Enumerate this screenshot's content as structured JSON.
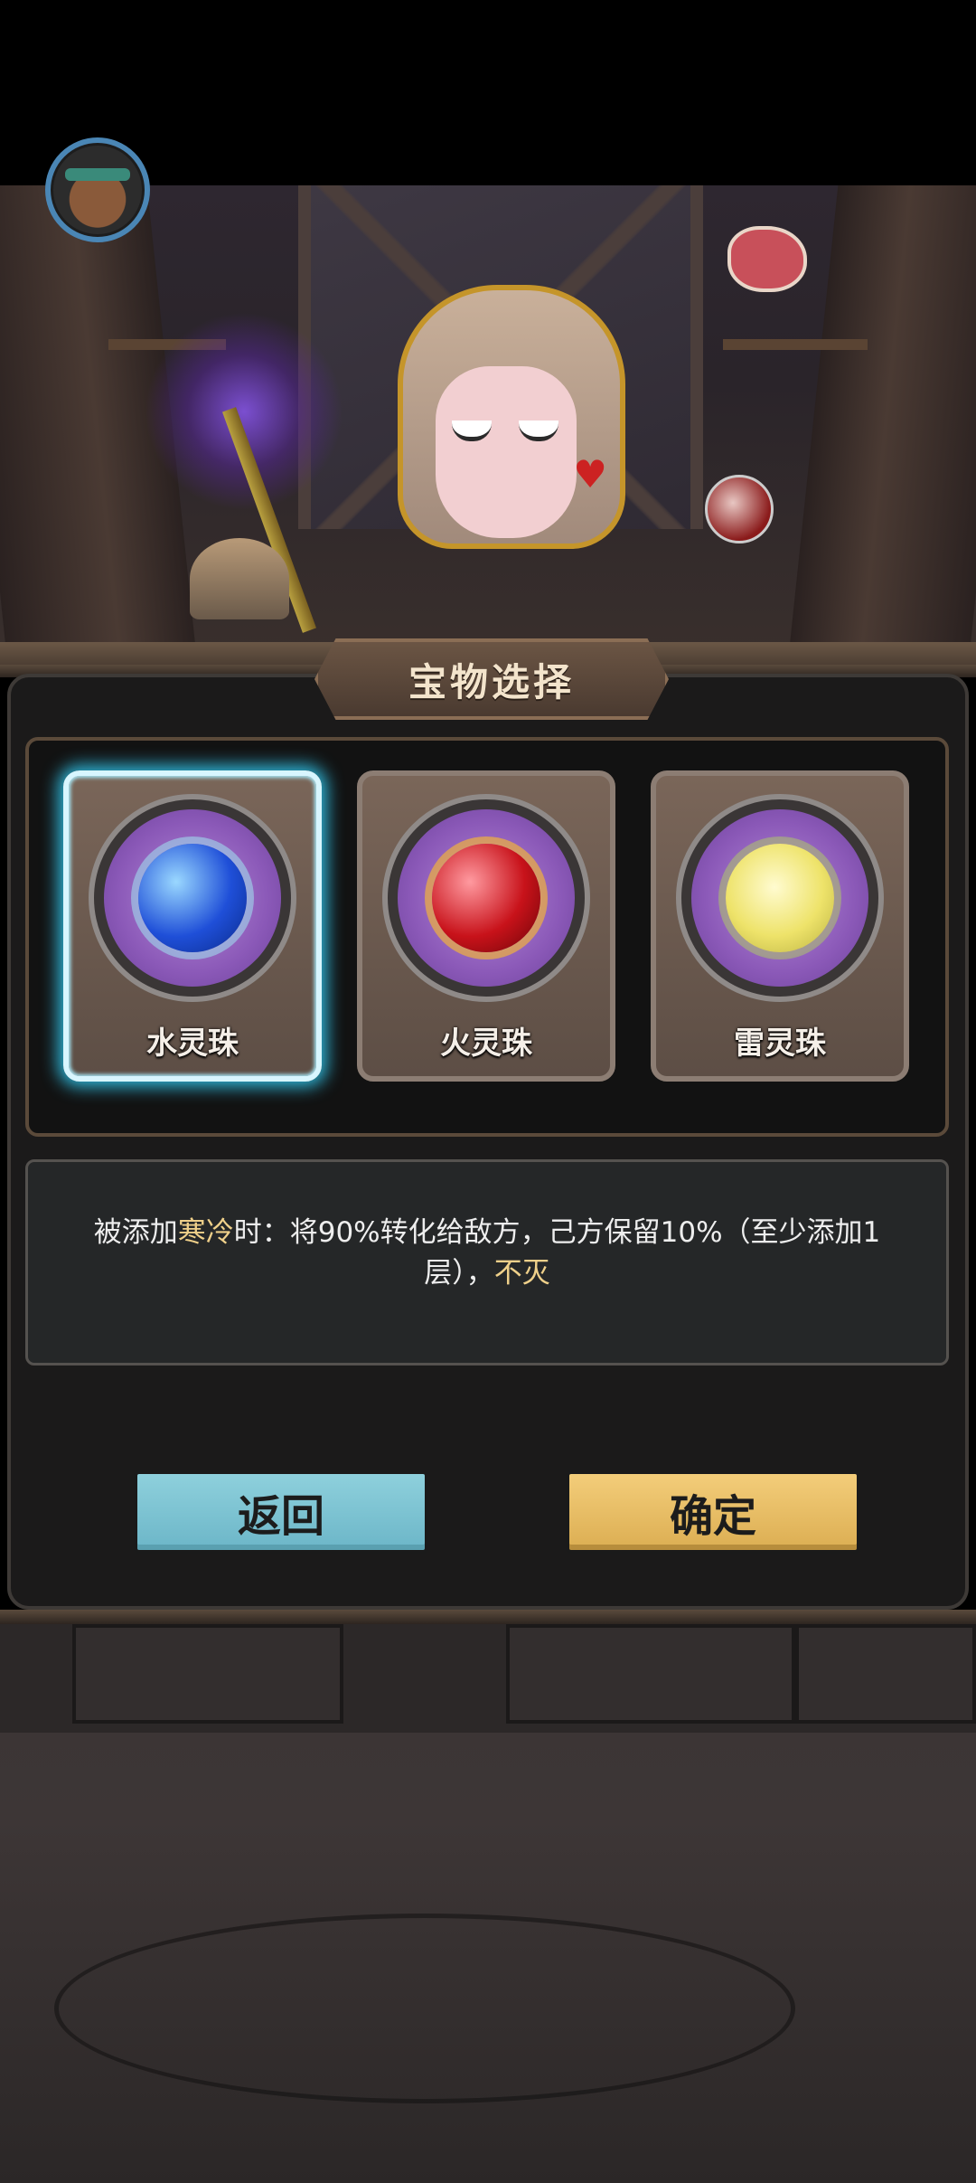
{
  "header": {
    "avatar_icon": "player-avatar-icon"
  },
  "dialog": {
    "title": "宝物选择",
    "options": [
      {
        "label": "水灵珠",
        "icon": "water-orb-icon",
        "selected": true
      },
      {
        "label": "火灵珠",
        "icon": "fire-orb-icon",
        "selected": false
      },
      {
        "label": "雷灵珠",
        "icon": "thunder-orb-icon",
        "selected": false
      }
    ],
    "description": {
      "part1": "被添加",
      "highlight1": "寒冷",
      "part2": "时：将90%转化给敌方，己方保留10%（至少添加1层），",
      "highlight2": "不灭"
    },
    "buttons": {
      "back": "返回",
      "confirm": "确定"
    }
  },
  "colors": {
    "selected_glow": "#2fb6d8",
    "back_button": "#7ec4d2",
    "confirm_button": "#e8be66",
    "highlight_text": "#efd08a"
  }
}
